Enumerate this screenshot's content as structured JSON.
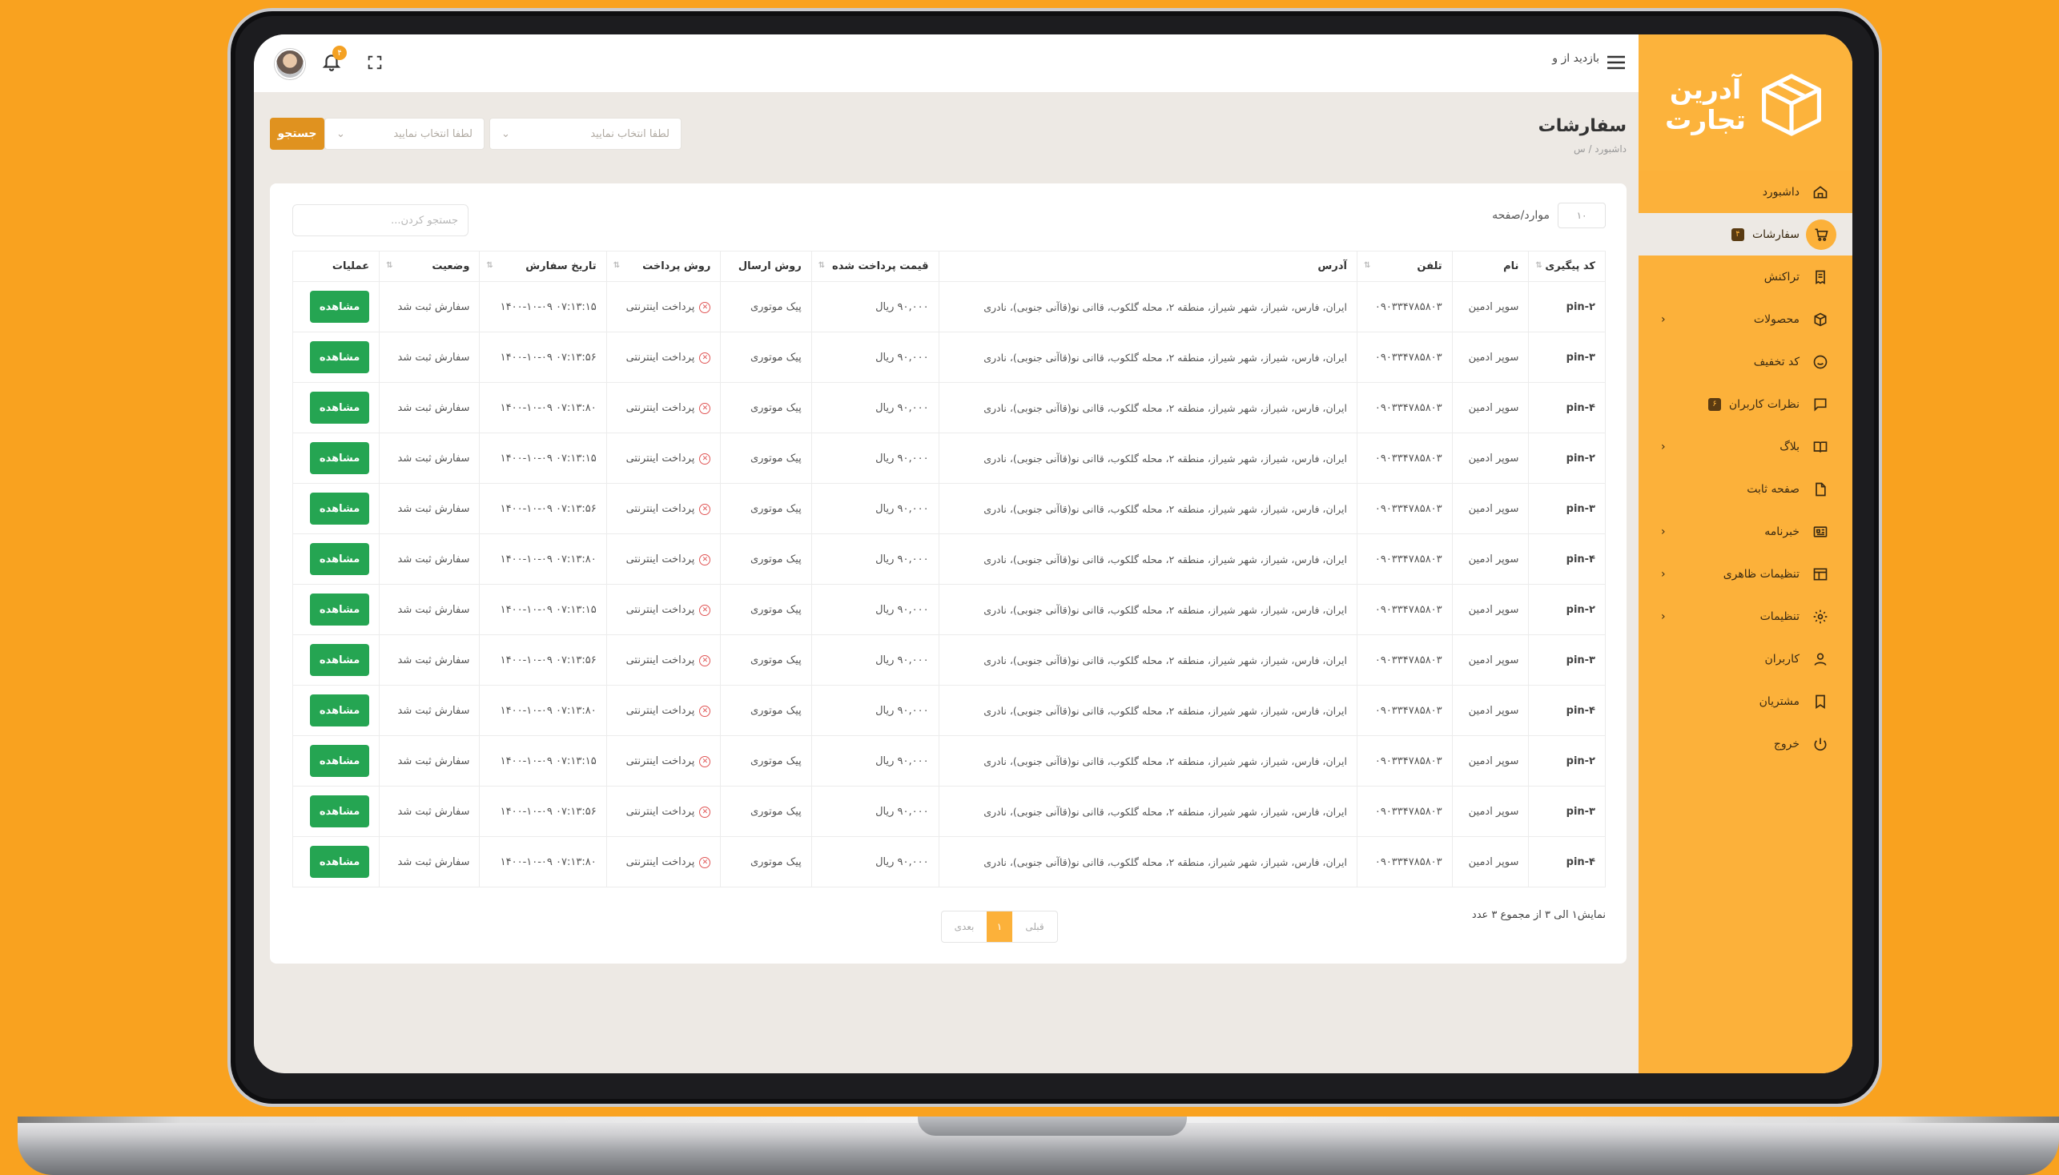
{
  "brand": {
    "line1": "آدرین",
    "line2": "تجارت"
  },
  "sidebar": {
    "items": [
      {
        "label": "داشبورد",
        "icon": "home-icon"
      },
      {
        "label": "سفارشات",
        "icon": "cart-icon",
        "badge": "۴",
        "active": true
      },
      {
        "label": "تراکنش",
        "icon": "receipt-icon"
      },
      {
        "label": "محصولات",
        "icon": "box-icon",
        "chevron": "‹"
      },
      {
        "label": "کد تخفیف",
        "icon": "smile-icon"
      },
      {
        "label": "نظرات کاربران",
        "icon": "comment-icon",
        "badge": "۶"
      },
      {
        "label": "بلاگ",
        "icon": "book-icon",
        "chevron": "‹"
      },
      {
        "label": "صفحه ثابت",
        "icon": "file-icon"
      },
      {
        "label": "خبرنامه",
        "icon": "newsletter-icon",
        "chevron": "‹"
      },
      {
        "label": "تنظیمات ظاهری",
        "icon": "layout-icon",
        "chevron": "‹"
      },
      {
        "label": "تنظیمات",
        "icon": "gear-icon",
        "chevron": "‹"
      },
      {
        "label": "کاربران",
        "icon": "user-icon"
      },
      {
        "label": "مشتریان",
        "icon": "bookmark-icon"
      },
      {
        "label": "خروج",
        "icon": "power-icon"
      }
    ]
  },
  "topbar": {
    "visit_label": "بازدید از و",
    "notification_count": "۴"
  },
  "header": {
    "title": "سفارشات",
    "breadcrumb": "داشبورد  /  س"
  },
  "filters": {
    "select1_placeholder": "لطفا انتخاب نمایید",
    "select2_placeholder": "لطفا انتخاب نمایید",
    "search_label": "جستجو"
  },
  "table_controls": {
    "per_page_value": "۱۰",
    "per_page_label": "موارد/صفحه",
    "search_placeholder": "جستجو کردن..."
  },
  "table": {
    "columns": [
      "کد پیگیری",
      "نام",
      "تلفن",
      "آدرس",
      "قیمت پرداخت شده",
      "روش ارسال",
      "روش پرداخت",
      "تاریخ سفارش",
      "وضعیت",
      "عملیات"
    ],
    "rows": [
      {
        "code": "pin-۲",
        "name": "سوپر ادمین",
        "phone": "۰۹۰۳۳۴۷۸۵۸۰۳",
        "address": "ایران، فارس، شیراز، شهر شیراز، منطقه ۲، محله گلکوب، قاانی نو(قاآنی جنوبی)، نادری",
        "price": "۹۰,۰۰۰ ریال",
        "shipping": "پیک موتوری",
        "payment": "پرداخت اینترنتی",
        "date": "۰۷:۱۳:۱۵ ۱۴۰۰-۱۰-۰۹",
        "status": "سفارش ثبت شد",
        "action": "مشاهده"
      },
      {
        "code": "pin-۳",
        "name": "سوپر ادمین",
        "phone": "۰۹۰۳۳۴۷۸۵۸۰۳",
        "address": "ایران، فارس، شیراز، شهر شیراز، منطقه ۲، محله گلکوب، قاانی نو(قاآنی جنوبی)، نادری",
        "price": "۹۰,۰۰۰ ریال",
        "shipping": "پیک موتوری",
        "payment": "پرداخت اینترنتی",
        "date": "۰۷:۱۳:۵۶ ۱۴۰۰-۱۰-۰۹",
        "status": "سفارش ثبت شد",
        "action": "مشاهده"
      },
      {
        "code": "pin-۴",
        "name": "سوپر ادمین",
        "phone": "۰۹۰۳۳۴۷۸۵۸۰۳",
        "address": "ایران، فارس، شیراز، شهر شیراز، منطقه ۲، محله گلکوب، قاانی نو(قاآنی جنوبی)، نادری",
        "price": "۹۰,۰۰۰ ریال",
        "shipping": "پیک موتوری",
        "payment": "پرداخت اینترنتی",
        "date": "۰۷:۱۳:۸۰ ۱۴۰۰-۱۰-۰۹",
        "status": "سفارش ثبت شد",
        "action": "مشاهده"
      },
      {
        "code": "pin-۲",
        "name": "سوپر ادمین",
        "phone": "۰۹۰۳۳۴۷۸۵۸۰۳",
        "address": "ایران، فارس، شیراز، شهر شیراز، منطقه ۲، محله گلکوب، قاانی نو(قاآنی جنوبی)، نادری",
        "price": "۹۰,۰۰۰ ریال",
        "shipping": "پیک موتوری",
        "payment": "پرداخت اینترنتی",
        "date": "۰۷:۱۳:۱۵ ۱۴۰۰-۱۰-۰۹",
        "status": "سفارش ثبت شد",
        "action": "مشاهده"
      },
      {
        "code": "pin-۳",
        "name": "سوپر ادمین",
        "phone": "۰۹۰۳۳۴۷۸۵۸۰۳",
        "address": "ایران، فارس، شیراز، شهر شیراز، منطقه ۲، محله گلکوب، قاانی نو(قاآنی جنوبی)، نادری",
        "price": "۹۰,۰۰۰ ریال",
        "shipping": "پیک موتوری",
        "payment": "پرداخت اینترنتی",
        "date": "۰۷:۱۳:۵۶ ۱۴۰۰-۱۰-۰۹",
        "status": "سفارش ثبت شد",
        "action": "مشاهده"
      },
      {
        "code": "pin-۴",
        "name": "سوپر ادمین",
        "phone": "۰۹۰۳۳۴۷۸۵۸۰۳",
        "address": "ایران، فارس، شیراز، شهر شیراز، منطقه ۲، محله گلکوب، قاانی نو(قاآنی جنوبی)، نادری",
        "price": "۹۰,۰۰۰ ریال",
        "shipping": "پیک موتوری",
        "payment": "پرداخت اینترنتی",
        "date": "۰۷:۱۳:۸۰ ۱۴۰۰-۱۰-۰۹",
        "status": "سفارش ثبت شد",
        "action": "مشاهده"
      },
      {
        "code": "pin-۲",
        "name": "سوپر ادمین",
        "phone": "۰۹۰۳۳۴۷۸۵۸۰۳",
        "address": "ایران، فارس، شیراز، شهر شیراز، منطقه ۲، محله گلکوب، قاانی نو(قاآنی جنوبی)، نادری",
        "price": "۹۰,۰۰۰ ریال",
        "shipping": "پیک موتوری",
        "payment": "پرداخت اینترنتی",
        "date": "۰۷:۱۳:۱۵ ۱۴۰۰-۱۰-۰۹",
        "status": "سفارش ثبت شد",
        "action": "مشاهده"
      },
      {
        "code": "pin-۳",
        "name": "سوپر ادمین",
        "phone": "۰۹۰۳۳۴۷۸۵۸۰۳",
        "address": "ایران، فارس، شیراز، شهر شیراز، منطقه ۲، محله گلکوب، قاانی نو(قاآنی جنوبی)، نادری",
        "price": "۹۰,۰۰۰ ریال",
        "shipping": "پیک موتوری",
        "payment": "پرداخت اینترنتی",
        "date": "۰۷:۱۳:۵۶ ۱۴۰۰-۱۰-۰۹",
        "status": "سفارش ثبت شد",
        "action": "مشاهده"
      },
      {
        "code": "pin-۴",
        "name": "سوپر ادمین",
        "phone": "۰۹۰۳۳۴۷۸۵۸۰۳",
        "address": "ایران، فارس، شیراز، شهر شیراز، منطقه ۲، محله گلکوب، قاانی نو(قاآنی جنوبی)، نادری",
        "price": "۹۰,۰۰۰ ریال",
        "shipping": "پیک موتوری",
        "payment": "پرداخت اینترنتی",
        "date": "۰۷:۱۳:۸۰ ۱۴۰۰-۱۰-۰۹",
        "status": "سفارش ثبت شد",
        "action": "مشاهده"
      },
      {
        "code": "pin-۲",
        "name": "سوپر ادمین",
        "phone": "۰۹۰۳۳۴۷۸۵۸۰۳",
        "address": "ایران، فارس، شیراز، شهر شیراز، منطقه ۲، محله گلکوب، قاانی نو(قاآنی جنوبی)، نادری",
        "price": "۹۰,۰۰۰ ریال",
        "shipping": "پیک موتوری",
        "payment": "پرداخت اینترنتی",
        "date": "۰۷:۱۳:۱۵ ۱۴۰۰-۱۰-۰۹",
        "status": "سفارش ثبت شد",
        "action": "مشاهده"
      },
      {
        "code": "pin-۳",
        "name": "سوپر ادمین",
        "phone": "۰۹۰۳۳۴۷۸۵۸۰۳",
        "address": "ایران، فارس، شیراز، شهر شیراز، منطقه ۲، محله گلکوب، قاانی نو(قاآنی جنوبی)، نادری",
        "price": "۹۰,۰۰۰ ریال",
        "shipping": "پیک موتوری",
        "payment": "پرداخت اینترنتی",
        "date": "۰۷:۱۳:۵۶ ۱۴۰۰-۱۰-۰۹",
        "status": "سفارش ثبت شد",
        "action": "مشاهده"
      },
      {
        "code": "pin-۴",
        "name": "سوپر ادمین",
        "phone": "۰۹۰۳۳۴۷۸۵۸۰۳",
        "address": "ایران، فارس، شیراز، شهر شیراز، منطقه ۲، محله گلکوب، قاانی نو(قاآنی جنوبی)، نادری",
        "price": "۹۰,۰۰۰ ریال",
        "shipping": "پیک موتوری",
        "payment": "پرداخت اینترنتی",
        "date": "۰۷:۱۳:۸۰ ۱۴۰۰-۱۰-۰۹",
        "status": "سفارش ثبت شد",
        "action": "مشاهده"
      }
    ]
  },
  "footer": {
    "summary": "نمایش۱ الی ۳ از مجموع ۳ عدد",
    "prev_label": "قبلی",
    "current_page": "۱",
    "next_label": "بعدی"
  },
  "colors": {
    "accent": "#fcb13a",
    "background": "#f9a21f",
    "success": "#25a552",
    "danger": "#e05555"
  }
}
